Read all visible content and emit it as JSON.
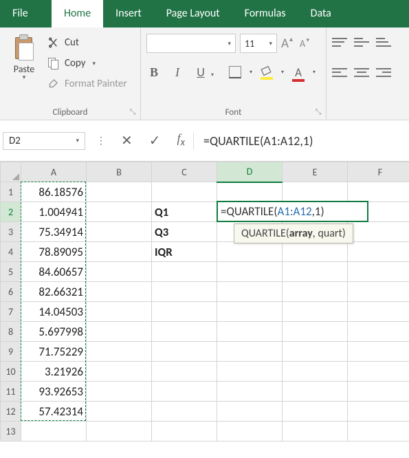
{
  "tabs": {
    "file": "File",
    "home": "Home",
    "insert": "Insert",
    "page_layout": "Page Layout",
    "formulas": "Formulas",
    "data": "Data"
  },
  "clipboard": {
    "paste": "Paste",
    "cut": "Cut",
    "copy": "Copy",
    "format_painter": "Format Painter",
    "group_label": "Clipboard"
  },
  "font": {
    "size_value": "11",
    "group_label": "Font",
    "bold": "B",
    "italic": "I",
    "underline": "U",
    "Abig": "A",
    "Asml": "A",
    "fontcolor_A": "A"
  },
  "name_box": "D2",
  "formula_bar": "=QUARTILE(A1:A12,1)",
  "grid": {
    "cols": [
      "A",
      "B",
      "C",
      "D",
      "E",
      "F"
    ],
    "rows": [
      {
        "h": "1",
        "A": "86.18576",
        "C": "",
        "D": ""
      },
      {
        "h": "2",
        "A": "1.004941",
        "C": "Q1",
        "D": ""
      },
      {
        "h": "3",
        "A": "75.34914",
        "C": "Q3",
        "D": ""
      },
      {
        "h": "4",
        "A": "78.89095",
        "C": "IQR",
        "D": ""
      },
      {
        "h": "5",
        "A": "84.60657",
        "C": "",
        "D": ""
      },
      {
        "h": "6",
        "A": "82.66321",
        "C": "",
        "D": ""
      },
      {
        "h": "7",
        "A": "14.04503",
        "C": "",
        "D": ""
      },
      {
        "h": "8",
        "A": "5.697998",
        "C": "",
        "D": ""
      },
      {
        "h": "9",
        "A": "71.75229",
        "C": "",
        "D": ""
      },
      {
        "h": "10",
        "A": "3.21926",
        "C": "",
        "D": ""
      },
      {
        "h": "11",
        "A": "93.92653",
        "C": "",
        "D": ""
      },
      {
        "h": "12",
        "A": "57.42314",
        "C": "",
        "D": ""
      },
      {
        "h": "13",
        "A": "",
        "C": "",
        "D": ""
      }
    ]
  },
  "edit_cell": {
    "prefix": "=QUARTILE(",
    "ref": "A1:A12",
    "suffix": ",1)"
  },
  "tooltip": {
    "fn": "QUARTILE(",
    "arg_bold": "array",
    "rest": ", quart)"
  }
}
